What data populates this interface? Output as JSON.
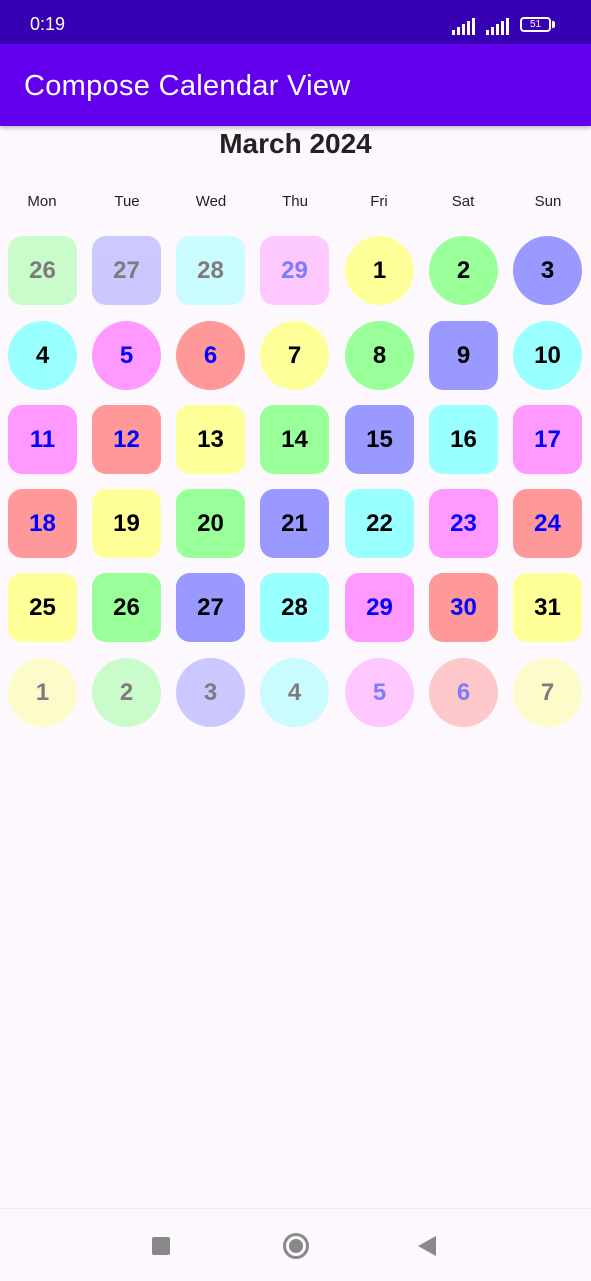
{
  "status_bar": {
    "time": "0:19",
    "battery": "51"
  },
  "app_bar": {
    "title": "Compose Calendar View"
  },
  "calendar": {
    "month_title": "March 2024",
    "weekdays": [
      "Mon",
      "Tue",
      "Wed",
      "Thu",
      "Fri",
      "Sat",
      "Sun"
    ],
    "days": [
      {
        "label": "26",
        "bg": "#99ff99",
        "fg": "#000000",
        "shape": "square",
        "current_month": false
      },
      {
        "label": "27",
        "bg": "#9999ff",
        "fg": "#000000",
        "shape": "square",
        "current_month": false
      },
      {
        "label": "28",
        "bg": "#99ffff",
        "fg": "#000000",
        "shape": "square",
        "current_month": false
      },
      {
        "label": "29",
        "bg": "#ff99ff",
        "fg": "#0000ff",
        "shape": "square",
        "current_month": false
      },
      {
        "label": "1",
        "bg": "#ffff99",
        "fg": "#000000",
        "shape": "circle",
        "current_month": true
      },
      {
        "label": "2",
        "bg": "#99ff99",
        "fg": "#000000",
        "shape": "circle",
        "current_month": true
      },
      {
        "label": "3",
        "bg": "#9999ff",
        "fg": "#000000",
        "shape": "circle",
        "current_month": true
      },
      {
        "label": "4",
        "bg": "#99ffff",
        "fg": "#000000",
        "shape": "circle",
        "current_month": true
      },
      {
        "label": "5",
        "bg": "#ff99ff",
        "fg": "#0000ff",
        "shape": "circle",
        "current_month": true
      },
      {
        "label": "6",
        "bg": "#ff9999",
        "fg": "#0000ff",
        "shape": "circle",
        "current_month": true
      },
      {
        "label": "7",
        "bg": "#ffff99",
        "fg": "#000000",
        "shape": "circle",
        "current_month": true
      },
      {
        "label": "8",
        "bg": "#99ff99",
        "fg": "#000000",
        "shape": "circle",
        "current_month": true
      },
      {
        "label": "9",
        "bg": "#9999ff",
        "fg": "#000000",
        "shape": "square",
        "current_month": true
      },
      {
        "label": "10",
        "bg": "#99ffff",
        "fg": "#000000",
        "shape": "circle",
        "current_month": true
      },
      {
        "label": "11",
        "bg": "#ff99ff",
        "fg": "#0000ff",
        "shape": "square",
        "current_month": true
      },
      {
        "label": "12",
        "bg": "#ff9999",
        "fg": "#0000ff",
        "shape": "square",
        "current_month": true
      },
      {
        "label": "13",
        "bg": "#ffff99",
        "fg": "#000000",
        "shape": "square",
        "current_month": true
      },
      {
        "label": "14",
        "bg": "#99ff99",
        "fg": "#000000",
        "shape": "square",
        "current_month": true
      },
      {
        "label": "15",
        "bg": "#9999ff",
        "fg": "#000000",
        "shape": "square",
        "current_month": true
      },
      {
        "label": "16",
        "bg": "#99ffff",
        "fg": "#000000",
        "shape": "square",
        "current_month": true
      },
      {
        "label": "17",
        "bg": "#ff99ff",
        "fg": "#0000ff",
        "shape": "square",
        "current_month": true
      },
      {
        "label": "18",
        "bg": "#ff9999",
        "fg": "#0000ff",
        "shape": "square",
        "current_month": true
      },
      {
        "label": "19",
        "bg": "#ffff99",
        "fg": "#000000",
        "shape": "square",
        "current_month": true
      },
      {
        "label": "20",
        "bg": "#99ff99",
        "fg": "#000000",
        "shape": "square",
        "current_month": true
      },
      {
        "label": "21",
        "bg": "#9999ff",
        "fg": "#000000",
        "shape": "square",
        "current_month": true
      },
      {
        "label": "22",
        "bg": "#99ffff",
        "fg": "#000000",
        "shape": "square",
        "current_month": true
      },
      {
        "label": "23",
        "bg": "#ff99ff",
        "fg": "#0000ff",
        "shape": "square",
        "current_month": true
      },
      {
        "label": "24",
        "bg": "#ff9999",
        "fg": "#0000ff",
        "shape": "square",
        "current_month": true
      },
      {
        "label": "25",
        "bg": "#ffff99",
        "fg": "#000000",
        "shape": "square",
        "current_month": true
      },
      {
        "label": "26",
        "bg": "#99ff99",
        "fg": "#000000",
        "shape": "square",
        "current_month": true
      },
      {
        "label": "27",
        "bg": "#9999ff",
        "fg": "#000000",
        "shape": "square",
        "current_month": true
      },
      {
        "label": "28",
        "bg": "#99ffff",
        "fg": "#000000",
        "shape": "square",
        "current_month": true
      },
      {
        "label": "29",
        "bg": "#ff99ff",
        "fg": "#0000ff",
        "shape": "square",
        "current_month": true
      },
      {
        "label": "30",
        "bg": "#ff9999",
        "fg": "#0000ff",
        "shape": "square",
        "current_month": true
      },
      {
        "label": "31",
        "bg": "#ffff99",
        "fg": "#000000",
        "shape": "square",
        "current_month": true
      },
      {
        "label": "1",
        "bg": "#ffff99",
        "fg": "#000000",
        "shape": "circle",
        "current_month": false
      },
      {
        "label": "2",
        "bg": "#99ff99",
        "fg": "#000000",
        "shape": "circle",
        "current_month": false
      },
      {
        "label": "3",
        "bg": "#9999ff",
        "fg": "#000000",
        "shape": "circle",
        "current_month": false
      },
      {
        "label": "4",
        "bg": "#99ffff",
        "fg": "#000000",
        "shape": "circle",
        "current_month": false
      },
      {
        "label": "5",
        "bg": "#ff99ff",
        "fg": "#0000ff",
        "shape": "circle",
        "current_month": false
      },
      {
        "label": "6",
        "bg": "#ff9999",
        "fg": "#0000ff",
        "shape": "circle",
        "current_month": false
      },
      {
        "label": "7",
        "bg": "#ffff99",
        "fg": "#000000",
        "shape": "circle",
        "current_month": false
      }
    ]
  },
  "nav_bar": {
    "icons": [
      "recent-apps-icon",
      "home-icon",
      "back-icon"
    ]
  }
}
